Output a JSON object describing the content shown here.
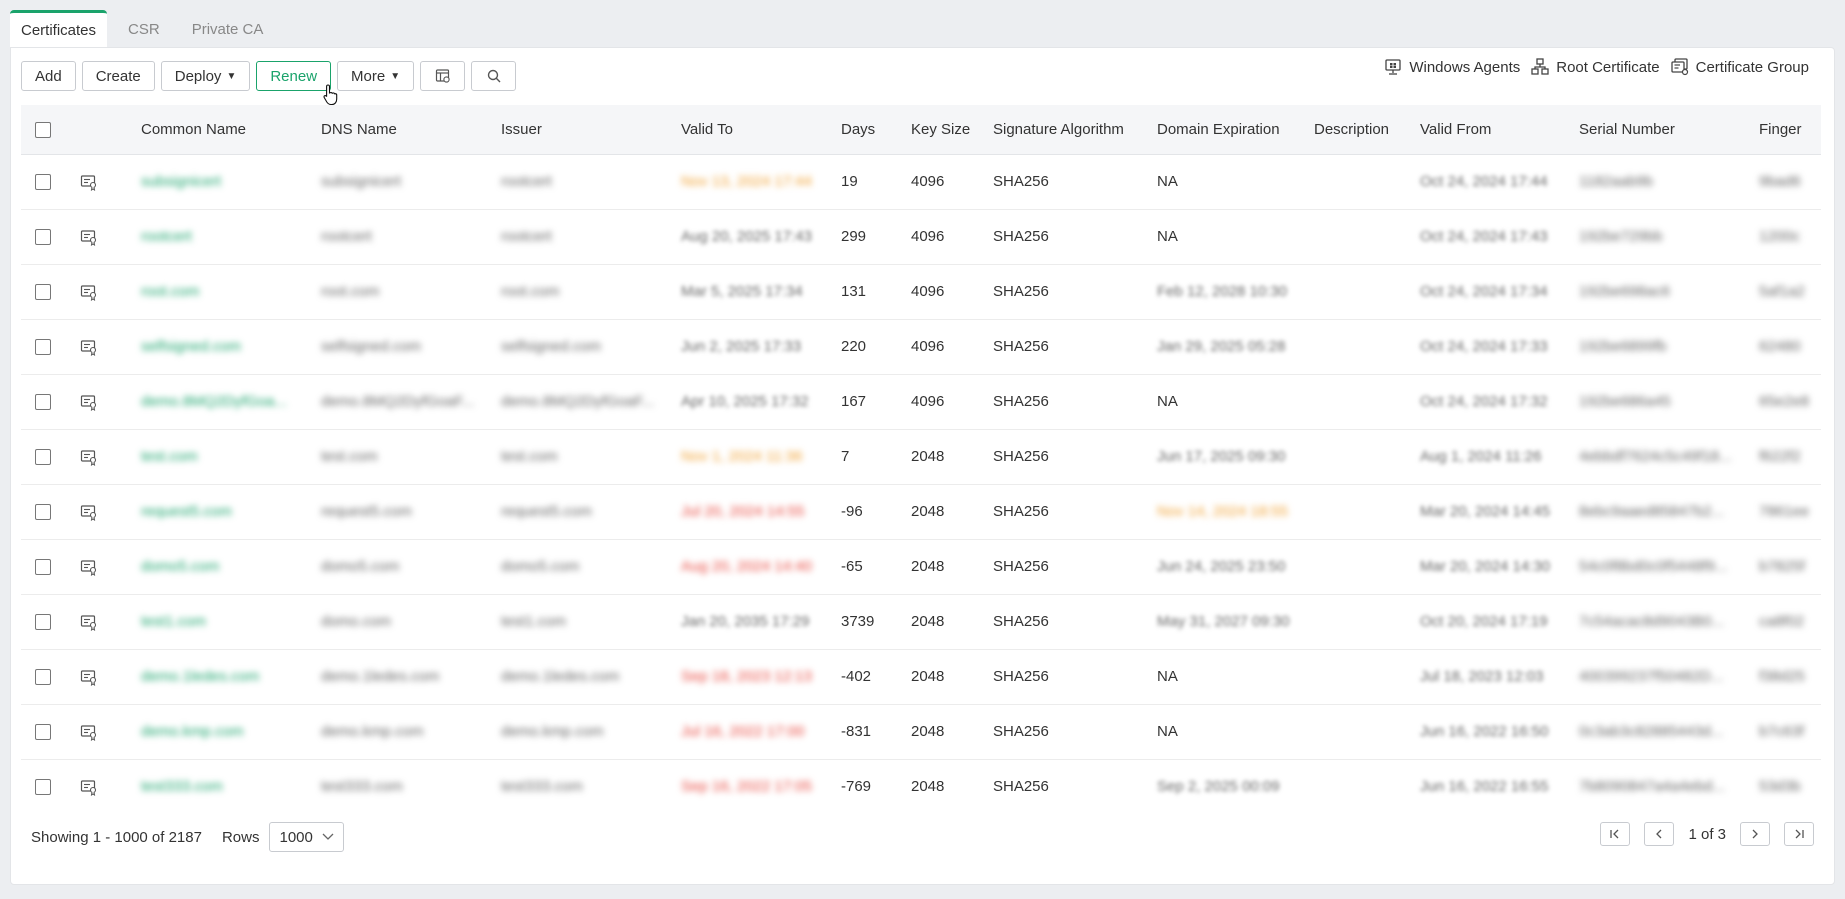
{
  "tabs": [
    {
      "label": "Certificates",
      "active": true
    },
    {
      "label": "CSR",
      "active": false
    },
    {
      "label": "Private CA",
      "active": false
    }
  ],
  "toolbar": {
    "add": "Add",
    "create": "Create",
    "deploy": "Deploy",
    "renew": "Renew",
    "more": "More"
  },
  "right_links": {
    "windows_agents": "Windows Agents",
    "root_certificate": "Root Certificate",
    "certificate_group": "Certificate Group"
  },
  "columns": [
    "Common Name",
    "DNS Name",
    "Issuer",
    "Valid To",
    "Days",
    "Key Size",
    "Signature Algorithm",
    "Domain Expiration",
    "Description",
    "Valid From",
    "Serial Number",
    "Finger"
  ],
  "rows": [
    {
      "cn": "subsignicert",
      "dns": "subsignicert",
      "issuer": "rootcert",
      "valid_to": "Nov 13, 2024 17:44",
      "vt_color": "orange",
      "days": "19",
      "key": "4096",
      "sig": "SHA256",
      "dom": "NA",
      "dom_blur": false,
      "dom_color": "",
      "desc": "",
      "valid_from": "Oct 24, 2024 17:44",
      "vf_blur": true,
      "serial": "1182aab9b",
      "finger": "9bad6"
    },
    {
      "cn": "rootcert",
      "dns": "rootcert",
      "issuer": "rootcert",
      "valid_to": "Aug 20, 2025 17:43",
      "vt_color": "",
      "days": "299",
      "key": "4096",
      "sig": "SHA256",
      "dom": "NA",
      "dom_blur": false,
      "dom_color": "",
      "desc": "",
      "valid_from": "Oct 24, 2024 17:43",
      "vf_blur": true,
      "serial": "192be729bb",
      "finger": "1200c"
    },
    {
      "cn": "root.com",
      "dns": "root.com",
      "issuer": "root.com",
      "valid_to": "Mar 5, 2025 17:34",
      "vt_color": "",
      "days": "131",
      "key": "4096",
      "sig": "SHA256",
      "dom": "Feb 12, 2028 10:30",
      "dom_blur": true,
      "dom_color": "",
      "desc": "",
      "valid_from": "Oct 24, 2024 17:34",
      "vf_blur": true,
      "serial": "192be698ac6",
      "finger": "5af1a2"
    },
    {
      "cn": "selfsigned.com",
      "dns": "selfsigned.com",
      "issuer": "selfsigned.com",
      "valid_to": "Jun 2, 2025 17:33",
      "vt_color": "",
      "days": "220",
      "key": "4096",
      "sig": "SHA256",
      "dom": "Jan 29, 2025 05:28",
      "dom_blur": true,
      "dom_color": "",
      "desc": "",
      "valid_from": "Oct 24, 2024 17:33",
      "vf_blur": true,
      "serial": "192be6899fb",
      "finger": "62480"
    },
    {
      "cn": "demo.8MQ2DyfGoa...",
      "dns": "demo.8MQ2DyfGoaF...",
      "issuer": "demo.8MQ2DyfGoaF...",
      "valid_to": "Apr 10, 2025 17:32",
      "vt_color": "",
      "days": "167",
      "key": "4096",
      "sig": "SHA256",
      "dom": "NA",
      "dom_blur": false,
      "dom_color": "",
      "desc": "",
      "valid_from": "Oct 24, 2024 17:32",
      "vf_blur": true,
      "serial": "192be686a45",
      "finger": "65e2e8"
    },
    {
      "cn": "test.com",
      "dns": "test.com",
      "issuer": "test.com",
      "valid_to": "Nov 1, 2024 11:36",
      "vt_color": "orange",
      "days": "7",
      "key": "2048",
      "sig": "SHA256",
      "dom": "Jun 17, 2025 09:30",
      "dom_blur": true,
      "dom_color": "",
      "desc": "",
      "valid_from": "Aug 1, 2024 11:26",
      "vf_blur": true,
      "serial": "4ebbdf7624c5c49f18...",
      "finger": "f622f2"
    },
    {
      "cn": "request5.com",
      "dns": "request5.com",
      "issuer": "request5.com",
      "valid_to": "Jul 20, 2024 14:55",
      "vt_color": "red",
      "days": "-96",
      "key": "2048",
      "sig": "SHA256",
      "dom": "Nov 14, 2024 18:55",
      "dom_blur": true,
      "dom_color": "orange",
      "desc": "",
      "valid_from": "Mar 20, 2024 14:45",
      "vf_blur": true,
      "serial": "8ebc9aaed85847b2...",
      "finger": "7861ee"
    },
    {
      "cn": "domo5.com",
      "dns": "domo5.com",
      "issuer": "domo5.com",
      "valid_to": "Aug 20, 2024 14:40",
      "vt_color": "red",
      "days": "-65",
      "key": "2048",
      "sig": "SHA256",
      "dom": "Jun 24, 2025 23:50",
      "dom_blur": true,
      "dom_color": "",
      "desc": "",
      "valid_from": "Mar 20, 2024 14:30",
      "vf_blur": true,
      "serial": "54c0f8bd0c0f5448f9...",
      "finger": "b7825f"
    },
    {
      "cn": "test1.com",
      "dns": "domo.com",
      "issuer": "test1.com",
      "valid_to": "Jan 20, 2035 17:29",
      "vt_color": "",
      "days": "3739",
      "key": "2048",
      "sig": "SHA256",
      "dom": "May 31, 2027 09:30",
      "dom_blur": true,
      "dom_color": "",
      "desc": "",
      "valid_from": "Oct 20, 2024 17:19",
      "vf_blur": true,
      "serial": "7c54acac8d9043B0...",
      "finger": "ca8f02"
    },
    {
      "cn": "demo.1ledes.com",
      "dns": "demo.1ledes.com",
      "issuer": "demo.1ledes.com",
      "valid_to": "Sep 18, 2023 12:13",
      "vt_color": "red",
      "days": "-402",
      "key": "2048",
      "sig": "SHA256",
      "dom": "NA",
      "dom_blur": false,
      "dom_color": "",
      "desc": "",
      "valid_from": "Jul 18, 2023 12:03",
      "vf_blur": true,
      "serial": "400399237f50482D...",
      "finger": "f38d25"
    },
    {
      "cn": "demo.kmp.com",
      "dns": "demo.kmp.com",
      "issuer": "demo.kmp.com",
      "valid_to": "Jul 16, 2022 17:00",
      "vt_color": "red",
      "days": "-831",
      "key": "2048",
      "sig": "SHA256",
      "dom": "NA",
      "dom_blur": false,
      "dom_color": "",
      "desc": "",
      "valid_from": "Jun 16, 2022 16:50",
      "vf_blur": true,
      "serial": "0c3ab3c82885443d...",
      "finger": "b7c63f"
    },
    {
      "cn": "test333.com",
      "dns": "test333.com",
      "issuer": "test333.com",
      "valid_to": "Sep 16, 2022 17:05",
      "vt_color": "red",
      "days": "-769",
      "key": "2048",
      "sig": "SHA256",
      "dom": "Sep 2, 2025 00:09",
      "dom_blur": true,
      "dom_color": "",
      "desc": "",
      "valid_from": "Jun 16, 2022 16:55",
      "vf_blur": true,
      "serial": "7b8090847a4a4ebd...",
      "finger": "53d3b"
    }
  ],
  "footer": {
    "showing": "Showing 1 - 1000 of 2187",
    "rows_label": "Rows",
    "rows_value": "1000",
    "page": "1 of 3"
  }
}
